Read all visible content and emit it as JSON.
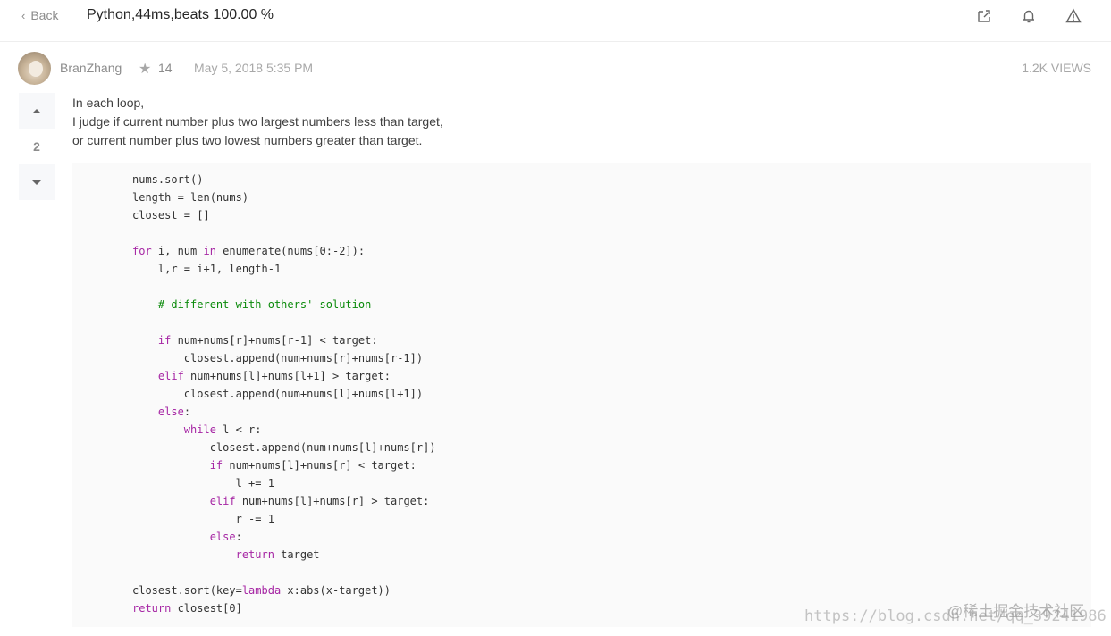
{
  "header": {
    "back_label": "Back",
    "title": "Python,44ms,beats 100.00 %",
    "icons": [
      "share-icon",
      "bell-icon",
      "report-warning-icon"
    ]
  },
  "post": {
    "author": "BranZhang",
    "reputation": "14",
    "date": "May 5, 2018 5:35 PM",
    "views": "1.2K VIEWS",
    "votes": "2",
    "paragraphs": [
      "In each loop,",
      "I judge if current number plus two largest numbers less than target,",
      "or current number plus two lowest numbers greater than target."
    ]
  },
  "code": {
    "lines": [
      "nums.sort()",
      "length = len(nums)",
      "closest = []",
      "",
      "for i, num in enumerate(nums[0:-2]):",
      "    l,r = i+1, length-1",
      "",
      "    # different with others' solution",
      "",
      "    if num+nums[r]+nums[r-1] < target:",
      "        closest.append(num+nums[r]+nums[r-1])",
      "    elif num+nums[l]+nums[l+1] > target:",
      "        closest.append(num+nums[l]+nums[l+1])",
      "    else:",
      "        while l < r:",
      "            closest.append(num+nums[l]+nums[r])",
      "            if num+nums[l]+nums[r] < target:",
      "                l += 1",
      "            elif num+nums[l]+nums[r] > target:",
      "                r -= 1",
      "            else:",
      "                return target",
      "",
      "closest.sort(key=lambda x:abs(x-target))",
      "return closest[0]"
    ]
  },
  "watermark": {
    "url": "https://blog.csdn.net/qq_39241986",
    "brand": "@稀土掘金技术社区"
  },
  "colors": {
    "keyword": "#a626a4",
    "comment": "#0a8a0a",
    "code_bg": "#fafafa"
  }
}
